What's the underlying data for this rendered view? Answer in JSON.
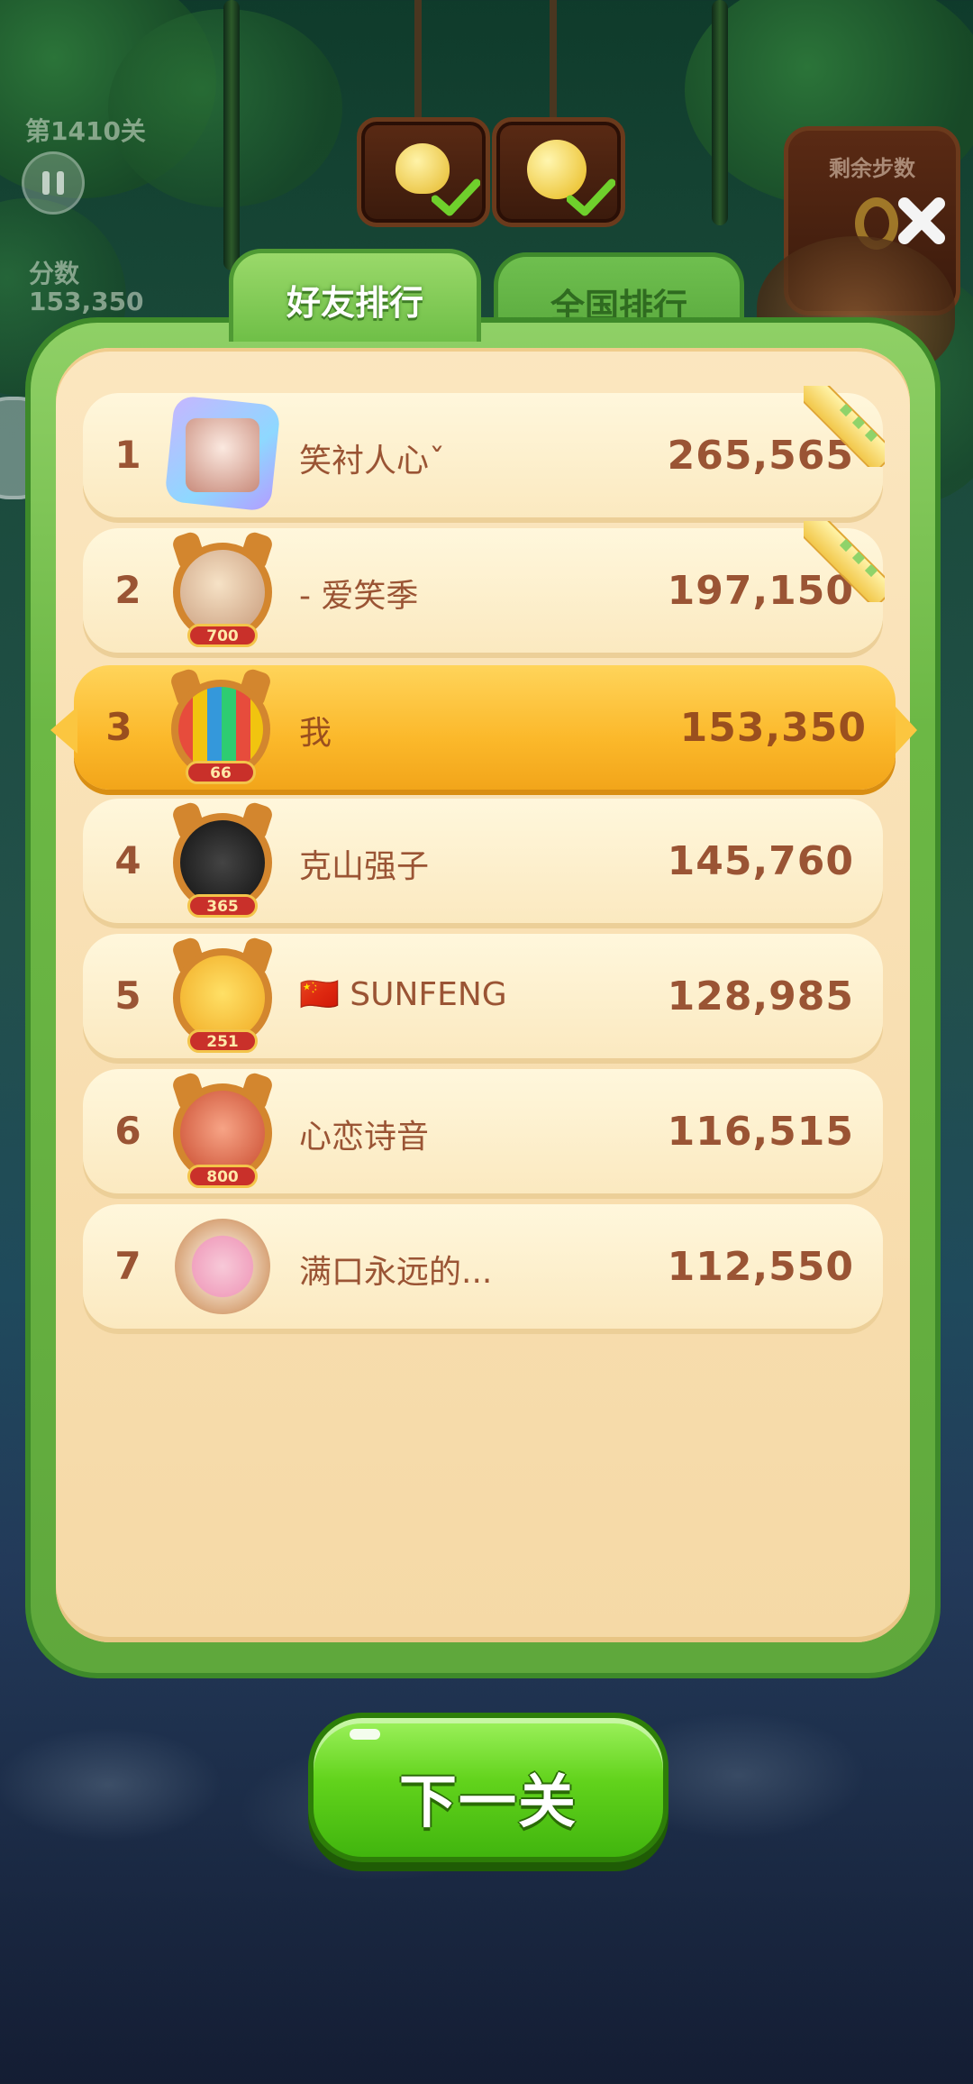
{
  "hud": {
    "level": "第1410关",
    "score_label": "分数",
    "score_value": "153,350",
    "moves_label": "剩余步数"
  },
  "tabs": [
    {
      "label": "好友排行",
      "active": true
    },
    {
      "label": "全国排行",
      "active": false
    }
  ],
  "leaderboard": [
    {
      "rank": "1",
      "name": "笑衬人心ˇ",
      "score": "265,565",
      "badge": "",
      "avatar": "gem-frame-avatar",
      "ribbon": true
    },
    {
      "rank": "2",
      "name": "- 爱笑季",
      "score": "197,150",
      "badge": "700",
      "avatar": "cat-frame-avatar",
      "ribbon": true
    },
    {
      "rank": "3",
      "name": "我",
      "score": "153,350",
      "badge": "66",
      "avatar": "cat-frame-avatar",
      "ribbon": false,
      "is_me": true
    },
    {
      "rank": "4",
      "name": "克山强子",
      "score": "145,760",
      "badge": "365",
      "avatar": "cat-frame-avatar",
      "ribbon": false
    },
    {
      "rank": "5",
      "name": "🇨🇳 SUNFENG",
      "score": "128,985",
      "badge": "251",
      "avatar": "cat-frame-avatar",
      "ribbon": false
    },
    {
      "rank": "6",
      "name": "心恋诗音",
      "score": "116,515",
      "badge": "800",
      "avatar": "cat-frame-avatar",
      "ribbon": false
    },
    {
      "rank": "7",
      "name": "满口永远的...",
      "score": "112,550",
      "badge": "",
      "avatar": "flower-frame-avatar",
      "ribbon": false
    }
  ],
  "next_button": {
    "label": "下一关"
  },
  "colors": {
    "panel_green": "#6cb845",
    "row_bg": "#fff7dc",
    "me_row": "#fbb82a",
    "text_brown": "#9a5434",
    "button_green": "#62d31c"
  }
}
